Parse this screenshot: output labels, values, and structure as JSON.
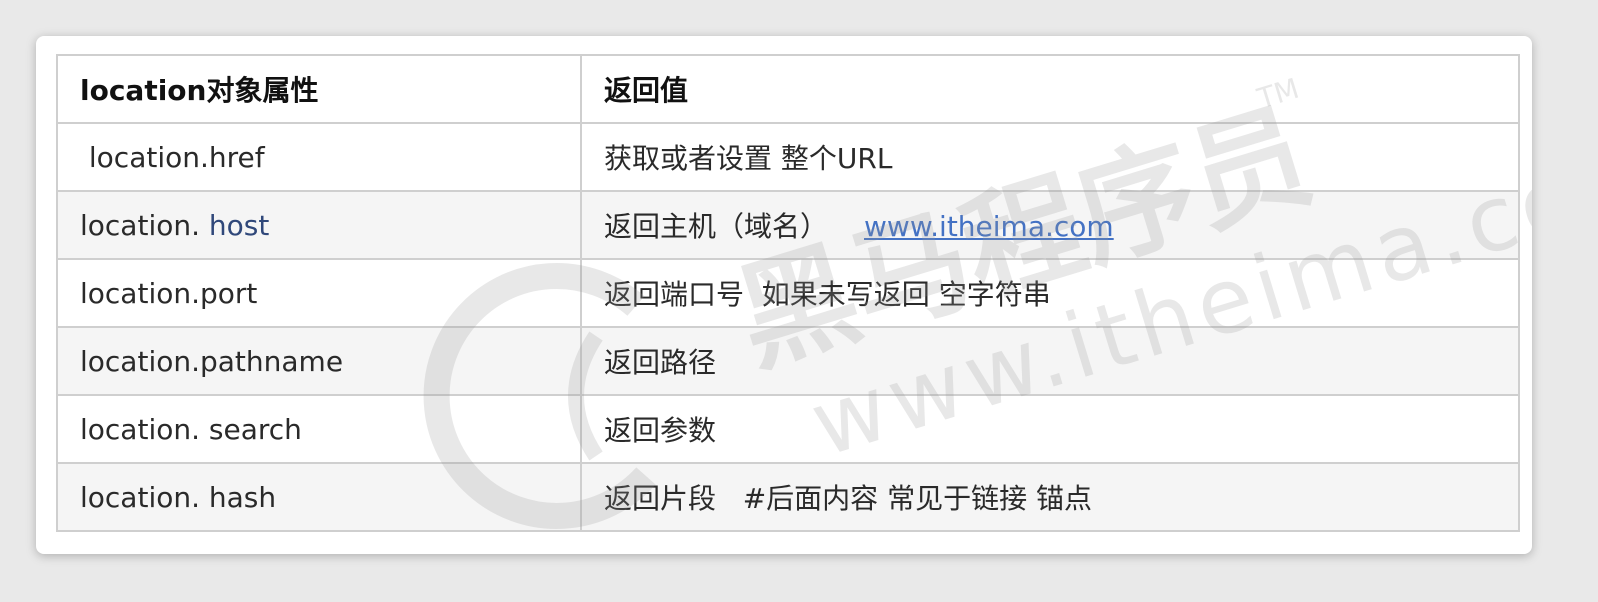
{
  "table": {
    "headers": [
      "location对象属性",
      "返回值"
    ],
    "rows": [
      {
        "prop_prefix": " location.href",
        "prop_suffix": "",
        "desc": "获取或者设置 整个URL",
        "link": ""
      },
      {
        "prop_prefix": "location. ",
        "prop_suffix": "host",
        "desc": "返回主机（域名）",
        "link": "www.itheima.com"
      },
      {
        "prop_prefix": "location.port",
        "prop_suffix": "",
        "desc": "返回端口号  如果未写返回 空字符串",
        "link": ""
      },
      {
        "prop_prefix": "location.pathname",
        "prop_suffix": "",
        "desc": "返回路径",
        "link": ""
      },
      {
        "prop_prefix": "location. search",
        "prop_suffix": "",
        "desc": "返回参数",
        "link": ""
      },
      {
        "prop_prefix": "location. hash",
        "prop_suffix": "",
        "desc": "返回片段   #后面内容 常见于链接 锚点",
        "link": ""
      }
    ]
  },
  "watermark": {
    "brand": "黑马程序员",
    "tm": "TM",
    "url": "www.itheima.com"
  },
  "colors": {
    "link": "#4472c4",
    "border": "#cfcfcf",
    "row_shade": "#f3f3f3"
  }
}
